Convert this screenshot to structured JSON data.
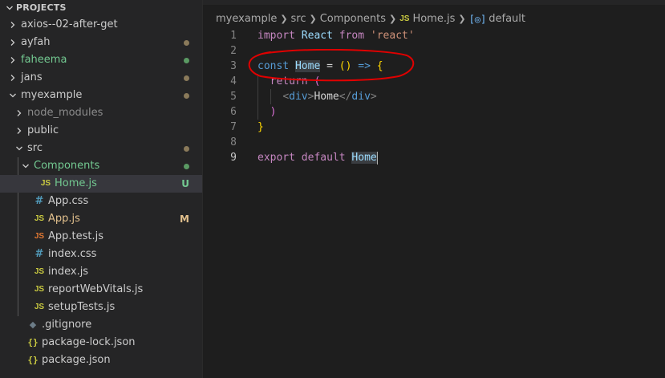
{
  "explorer": {
    "header": "PROJECTS",
    "items": [
      {
        "label": "axios--02-after-get",
        "type": "folder",
        "open": false,
        "depth": 0,
        "status": ""
      },
      {
        "label": "ayfah",
        "type": "folder",
        "open": false,
        "depth": 0,
        "status": "dot-brown"
      },
      {
        "label": "faheema",
        "type": "folder",
        "open": false,
        "depth": 0,
        "status": "dot-green",
        "color": "#73c991"
      },
      {
        "label": "jans",
        "type": "folder",
        "open": false,
        "depth": 0,
        "status": "dot-brown"
      },
      {
        "label": "myexample",
        "type": "folder",
        "open": true,
        "depth": 0,
        "status": "dot-brown"
      },
      {
        "label": "node_modules",
        "type": "folder",
        "open": false,
        "depth": 1,
        "status": "",
        "color": "#8c8c8c"
      },
      {
        "label": "public",
        "type": "folder",
        "open": false,
        "depth": 1,
        "status": ""
      },
      {
        "label": "src",
        "type": "folder",
        "open": true,
        "depth": 1,
        "status": "dot-brown"
      },
      {
        "label": "Components",
        "type": "folder",
        "open": true,
        "depth": 2,
        "status": "dot-green",
        "color": "#73c991"
      },
      {
        "label": "Home.js",
        "type": "js",
        "depth": 3,
        "status": "U",
        "color": "#73c991",
        "selected": true
      },
      {
        "label": "App.css",
        "type": "css",
        "depth": 2,
        "status": ""
      },
      {
        "label": "App.js",
        "type": "js",
        "depth": 2,
        "status": "M",
        "color": "#e2c08d"
      },
      {
        "label": "App.test.js",
        "type": "js-red",
        "depth": 2,
        "status": ""
      },
      {
        "label": "index.css",
        "type": "css",
        "depth": 2,
        "status": ""
      },
      {
        "label": "index.js",
        "type": "js",
        "depth": 2,
        "status": ""
      },
      {
        "label": "reportWebVitals.js",
        "type": "js",
        "depth": 2,
        "status": ""
      },
      {
        "label": "setupTests.js",
        "type": "js",
        "depth": 2,
        "status": ""
      },
      {
        "label": ".gitignore",
        "type": "git",
        "depth": 1,
        "status": ""
      },
      {
        "label": "package-lock.json",
        "type": "json",
        "depth": 1,
        "status": ""
      },
      {
        "label": "package.json",
        "type": "json",
        "depth": 1,
        "status": ""
      }
    ]
  },
  "icons": {
    "js": "JS",
    "css": "#",
    "json": "{}",
    "git": "◆",
    "symbol": "[◎]"
  },
  "breadcrumb": {
    "parts": [
      "myexample",
      "src",
      "Components",
      "Home.js",
      "default"
    ]
  },
  "editor": {
    "active_line": 9,
    "lines": [
      [
        {
          "t": "import",
          "c": "kw2"
        },
        {
          "t": " ",
          "c": "plain"
        },
        {
          "t": "React",
          "c": "var"
        },
        {
          "t": " ",
          "c": "plain"
        },
        {
          "t": "from",
          "c": "kw2"
        },
        {
          "t": " ",
          "c": "plain"
        },
        {
          "t": "'react'",
          "c": "str"
        }
      ],
      [],
      [
        {
          "t": "const",
          "c": "kw"
        },
        {
          "t": " ",
          "c": "plain"
        },
        {
          "t": "Home",
          "c": "var hl2"
        },
        {
          "t": " = ",
          "c": "plain"
        },
        {
          "t": "()",
          "c": "br1"
        },
        {
          "t": " ",
          "c": "plain"
        },
        {
          "t": "=>",
          "c": "kw"
        },
        {
          "t": " ",
          "c": "plain"
        },
        {
          "t": "{",
          "c": "br1"
        }
      ],
      [
        {
          "t": "  ",
          "c": "plain"
        },
        {
          "t": "return",
          "c": "kw2"
        },
        {
          "t": " ",
          "c": "plain"
        },
        {
          "t": "(",
          "c": "br2"
        }
      ],
      [
        {
          "t": "    ",
          "c": "plain"
        },
        {
          "t": "<",
          "c": "tag"
        },
        {
          "t": "div",
          "c": "tagname"
        },
        {
          "t": ">",
          "c": "tag"
        },
        {
          "t": "Home",
          "c": "plain"
        },
        {
          "t": "</",
          "c": "tag"
        },
        {
          "t": "div",
          "c": "tagname"
        },
        {
          "t": ">",
          "c": "tag"
        }
      ],
      [
        {
          "t": "  ",
          "c": "plain"
        },
        {
          "t": ")",
          "c": "br2"
        }
      ],
      [
        {
          "t": "}",
          "c": "br1"
        }
      ],
      [],
      [
        {
          "t": "export",
          "c": "kw2"
        },
        {
          "t": " ",
          "c": "plain"
        },
        {
          "t": "default",
          "c": "kw2"
        },
        {
          "t": " ",
          "c": "plain"
        },
        {
          "t": "Home",
          "c": "var hl2"
        }
      ]
    ]
  },
  "colors": {
    "annotation": "#e00000",
    "background": "#1e1e1e",
    "sidebar": "#252526"
  }
}
